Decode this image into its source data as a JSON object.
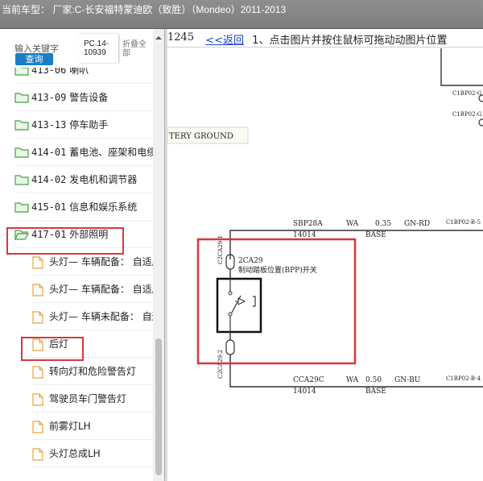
{
  "window": {
    "title": "当前车型：  厂家:C-长安福特蒙迪欧（致胜）（Mondeo）2011-2013"
  },
  "search": {
    "placeholder": "输入关键字",
    "query_button": "查询",
    "pc_code_line1": "PC.14-",
    "pc_code_line2": "10939",
    "collapse_line1": "折叠全",
    "collapse_line2": "部"
  },
  "tree": {
    "folders": [
      {
        "code": "413-06",
        "name": "喇叭"
      },
      {
        "code": "413-09",
        "name": "警告设备"
      },
      {
        "code": "413-13",
        "name": "停车助手"
      },
      {
        "code": "414-01",
        "name": "蓄电池、座架和电缆"
      },
      {
        "code": "414-02",
        "name": "发电机和调节器"
      },
      {
        "code": "415-01",
        "name": "信息和娱乐系统"
      },
      {
        "code": "417-01",
        "name": "外部照明"
      }
    ],
    "leaves": [
      "头灯— 车辆配备： 自适应",
      "头灯— 车辆配备： 自适应",
      "头灯— 车辆未配备： 自适应",
      "后灯",
      "转向灯和危险警告灯",
      "驾驶员车门警告灯",
      "前雾灯LH",
      "头灯总成LH"
    ]
  },
  "diagram_toolbar": {
    "page_number": "1245",
    "back_link": "<<返回",
    "instruction": "1、点击图片并按住鼠标可拖动动图片位置"
  },
  "diagram": {
    "battery_ground_label": "TERY GROUND",
    "top_labels": [
      "C1BP02-G",
      "C1BP02-G"
    ],
    "wire_top": {
      "name": "SBP28A",
      "circuit": "14014",
      "color_code": "WA",
      "gauge": "0.35",
      "wire_color": "GN-RD",
      "connector": "C1BP02-B-5",
      "base": "BASE"
    },
    "wire_bottom": {
      "name": "CCA29C",
      "circuit": "14014",
      "color_code": "WA",
      "gauge": "0.50",
      "wire_color": "GN-BU",
      "connector": "C1BP02-B-4",
      "base": "BASE"
    },
    "component": {
      "id": "2CA29",
      "name": "制动踏板位置(BPP)开关",
      "pin_top": "C2CA29-1",
      "pin_bottom": "C2CA29-2"
    }
  },
  "colors": {
    "titlebar": "#8a8a8a",
    "query_button": "#1a7ec6",
    "highlight": "#d9363e",
    "folder_icon": "#43a047",
    "file_icon": "#e8a33d",
    "link": "#1a3fbf"
  },
  "icons": {
    "folder_closed": "folder-icon",
    "folder_open": "folder-open-icon",
    "leaf": "file-icon"
  }
}
